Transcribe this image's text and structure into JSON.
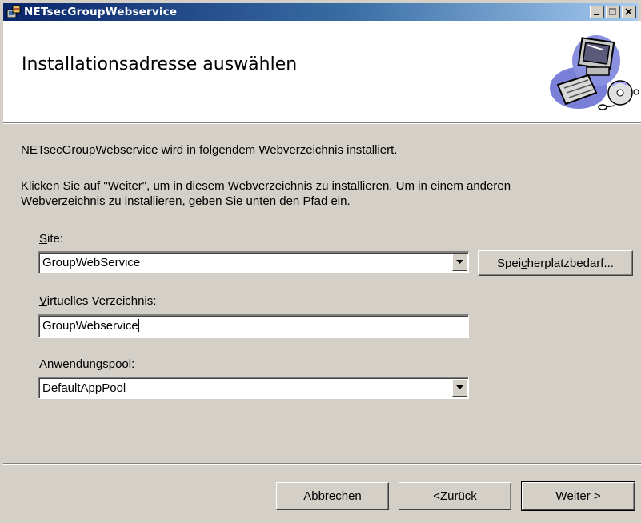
{
  "window": {
    "title": "NETsecGroupWebservice",
    "controls": {
      "minimize": "minimize",
      "maximize": "maximize",
      "close": "close"
    }
  },
  "header": {
    "title": "Installationsadresse auswählen",
    "graphic_icon": "computer-cd-icon"
  },
  "body": {
    "line1": "NETsecGroupWebservice wird in folgendem Webverzeichnis installiert.",
    "line2a": "Klicken Sie auf \"Weiter\", um in diesem Webverzeichnis zu installieren. Um in einem anderen",
    "line2b": "Webverzeichnis zu installieren, geben Sie unten den Pfad ein."
  },
  "site": {
    "label_accel": "S",
    "label_rest": "ite:",
    "value": "GroupWebService"
  },
  "disk_cost_button": {
    "pre": "Spei",
    "accel": "c",
    "post": "herplatzbedarf..."
  },
  "virtual_dir": {
    "label_accel": "V",
    "label_rest": "irtuelles Verzeichnis:",
    "value": "GroupWebservice"
  },
  "app_pool": {
    "label_accel": "A",
    "label_rest": "nwendungspool:",
    "value": "DefaultAppPool"
  },
  "footer": {
    "cancel": "Abbrechen",
    "back_pre": "< ",
    "back_accel": "Z",
    "back_post": "urück",
    "next_accel": "W",
    "next_post": "eiter >"
  }
}
